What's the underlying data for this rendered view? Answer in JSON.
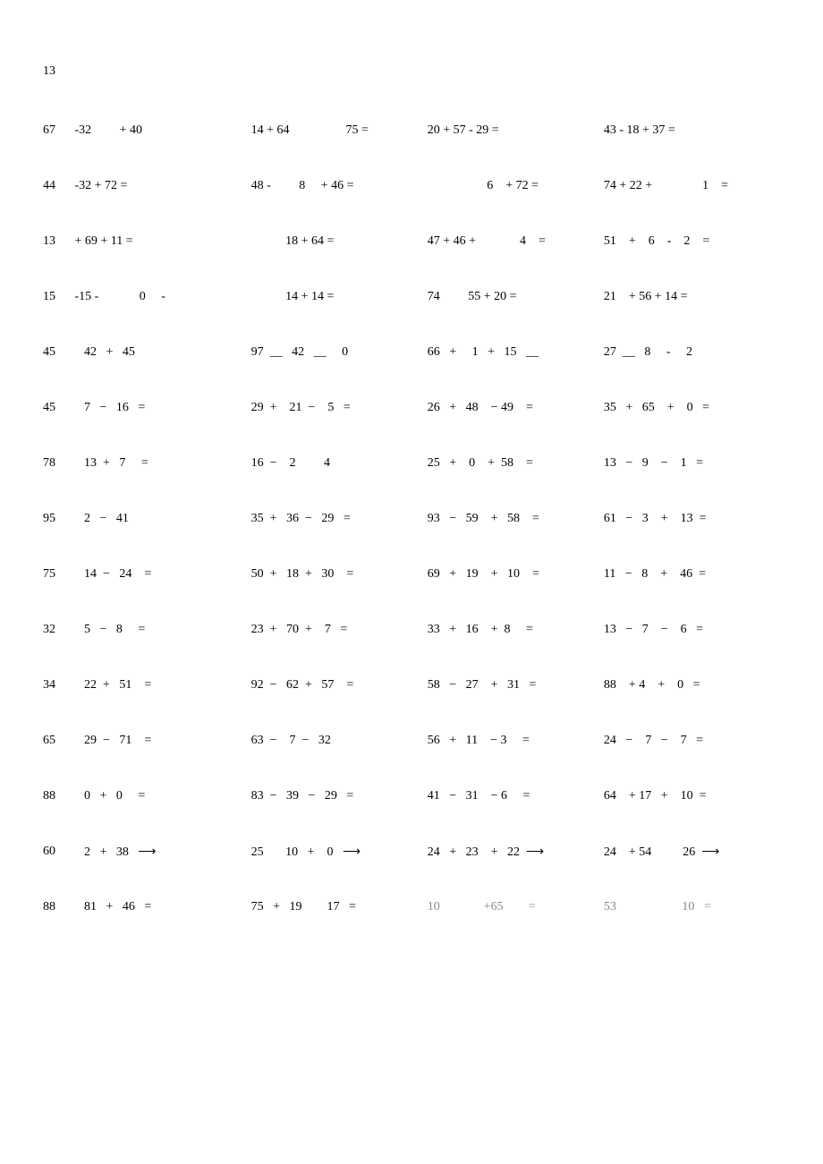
{
  "page_number": "13",
  "rows": [
    {
      "left": "67",
      "c1": "-32         + 40",
      "c2": "14 + 64                  75 =",
      "c3": "20 + 57 - 29 =",
      "c4": "43 - 18 + 37 ="
    },
    {
      "left": "44",
      "c1": "-32 + 72 =",
      "c2": "48 -         8     + 46 =",
      "c3": "                   6    + 72 =",
      "c4": "74 + 22 +                1    ="
    },
    {
      "left": "13",
      "c1": "+ 69 + 11 =",
      "c2": "           18 + 64 =",
      "c3": "47 + 46 +              4    =",
      "c4": "51    +    6    -    2    ="
    },
    {
      "left": "15",
      "c1": "-15 -             0     -",
      "c2": "           14 + 14 =",
      "c3": "74         55 + 20 =",
      "c4": "21    + 56 + 14 ="
    },
    {
      "left": "45",
      "c1": "   42   +   45",
      "c2": "97  __   42   __     0",
      "c3": "66   +     1   +   15   __",
      "c4": "27  __   8     -     2"
    },
    {
      "left": "45",
      "c1": "   7   −   16   =",
      "c2": "29  +    21  −    5   =",
      "c3": "26   +   48    − 49    =",
      "c4": "35   +   65    +    0   ="
    },
    {
      "left": "78",
      "c1": "   13  +   7     =",
      "c2": "16  −    2         4",
      "c3": "25   +    0    +  58    =",
      "c4": "13   −   9    −    1   ="
    },
    {
      "left": "95",
      "c1": "   2   −   41",
      "c2": "35  +   36  −   29   =",
      "c3": "93   −   59    +   58    =",
      "c4": "61   −   3    +    13  ="
    },
    {
      "left": "75",
      "c1": "   14  −   24    =",
      "c2": "50  +   18  +   30    =",
      "c3": "69   +   19    +   10    =",
      "c4": "11   −   8    +    46  ="
    },
    {
      "left": "32",
      "c1": "   5   −   8     =",
      "c2": "23  +   70  +    7   =",
      "c3": "33   +   16    +  8     =",
      "c4": "13   −   7    −    6   ="
    },
    {
      "left": "34",
      "c1": "   22  +   51    =",
      "c2": "92  −   62  +   57    =",
      "c3": "58   −   27    +   31   =",
      "c4": "88    + 4    +    0   ="
    },
    {
      "left": "65",
      "c1": "   29  −   71    =",
      "c2": "63  −    7  −   32",
      "c3": "56   +   11    − 3     =",
      "c4": "24   −    7   −    7   ="
    },
    {
      "left": "88",
      "c1": "   0   +   0     =",
      "c2": "83  −   39   −   29   =",
      "c3": "41   −   31    − 6     =",
      "c4": "64    + 17   +    10  ="
    },
    {
      "left": "60",
      "c1": "   2   +   38   ⟶",
      "c2": "25       10   +    0   ⟶",
      "c3": "24   +   23    +   22  ⟶",
      "c4": "24    + 54          26  ⟶"
    },
    {
      "left": "88",
      "c1": "   81   +   46   =",
      "c2": "75   +   19        17   =",
      "c3": "10              +65        =",
      "c4": "53                     10   =",
      "shade3": true,
      "shade4": true
    }
  ]
}
